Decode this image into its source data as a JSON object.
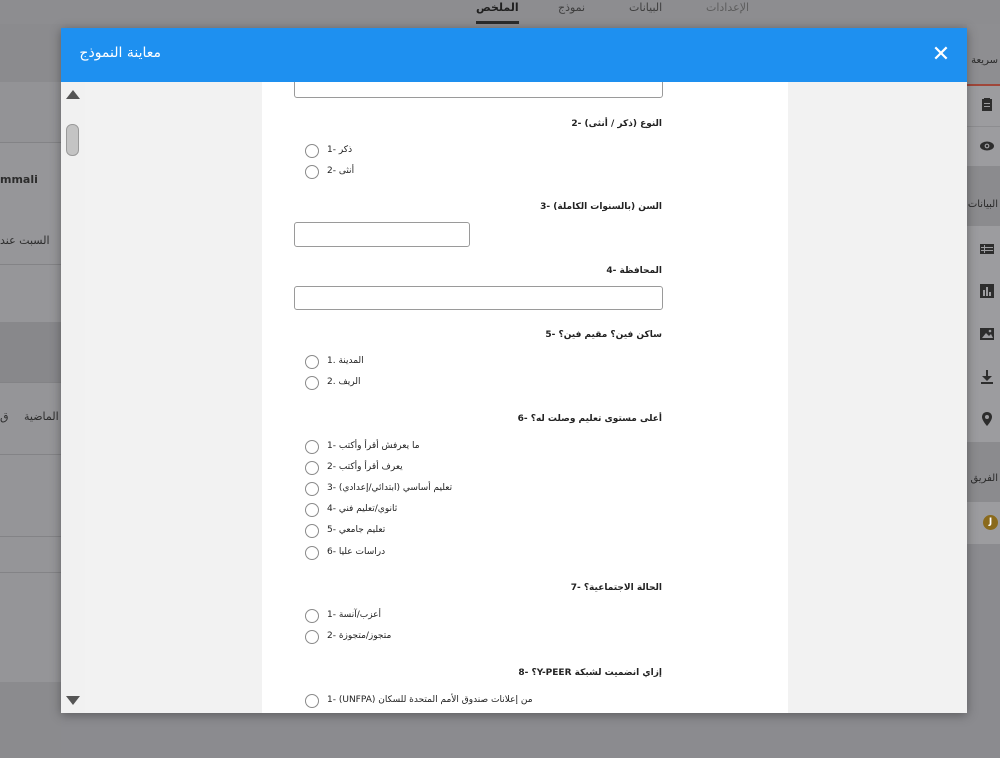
{
  "top_nav": {
    "tabs": [
      {
        "label": "الإعدادات"
      },
      {
        "label": "البيانات"
      },
      {
        "label": "نموذج"
      },
      {
        "label": "الملخص"
      }
    ]
  },
  "background": {
    "left_texts": [
      "mmali",
      "السبت عند",
      "الماضية",
      "ق"
    ],
    "right_labels": [
      "سريعة",
      "البيانات",
      "الفريق"
    ],
    "avatar_letter": "J"
  },
  "modal": {
    "title": "معاينة النموذج",
    "close_symbol": "✕"
  },
  "form": {
    "questions": [
      {
        "label": "النوع (ذكر / أنثى) -2",
        "options": [
          "ذكر -1",
          "أنثى -2"
        ]
      },
      {
        "label": "السن (بالسنوات الكاملة) -3"
      },
      {
        "label": "المحافظة -4"
      },
      {
        "label": "ساكن فين؟ مقيم فين؟ -5",
        "options": [
          "المدينة .1",
          "الريف .2"
        ]
      },
      {
        "label": "أعلى مستوى تعليم وصلت له؟ -6",
        "options": [
          "ما يعرفش أقرأ وأكتب -1",
          "يعرف أقرأ وأكتب -2",
          "تعليم أساسي (ابتدائي/إعدادي) -3",
          "ثانوي/تعليم فني -4",
          "تعليم جامعي -5",
          "دراسات عليا -6"
        ]
      },
      {
        "label": "الحالة الاجتماعية؟ -7",
        "options": [
          "أعزب/آنسة -1",
          "متجوز/متجوزة -2"
        ]
      },
      {
        "label": "إزاي انضميت لشبكة Y-PEER؟ -8",
        "options": [
          "من إعلانات صندوق الأمم المتحدة للسكان (UNFPA) -1"
        ]
      }
    ]
  }
}
